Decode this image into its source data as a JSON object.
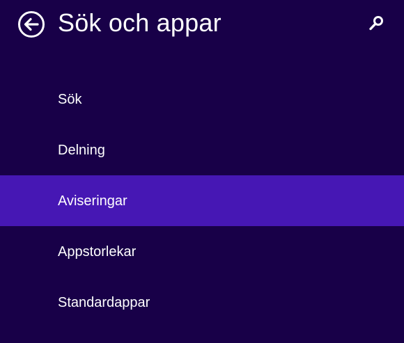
{
  "header": {
    "title": "Sök och appar",
    "back_icon": "back-arrow-circle-icon",
    "search_icon": "search-icon"
  },
  "nav": {
    "selected_index": 2,
    "items": [
      {
        "label": "Sök"
      },
      {
        "label": "Delning"
      },
      {
        "label": "Aviseringar"
      },
      {
        "label": "Appstorlekar"
      },
      {
        "label": "Standardappar"
      }
    ]
  },
  "colors": {
    "background": "#180048",
    "selected": "#4617b4",
    "text": "#ffffff"
  }
}
